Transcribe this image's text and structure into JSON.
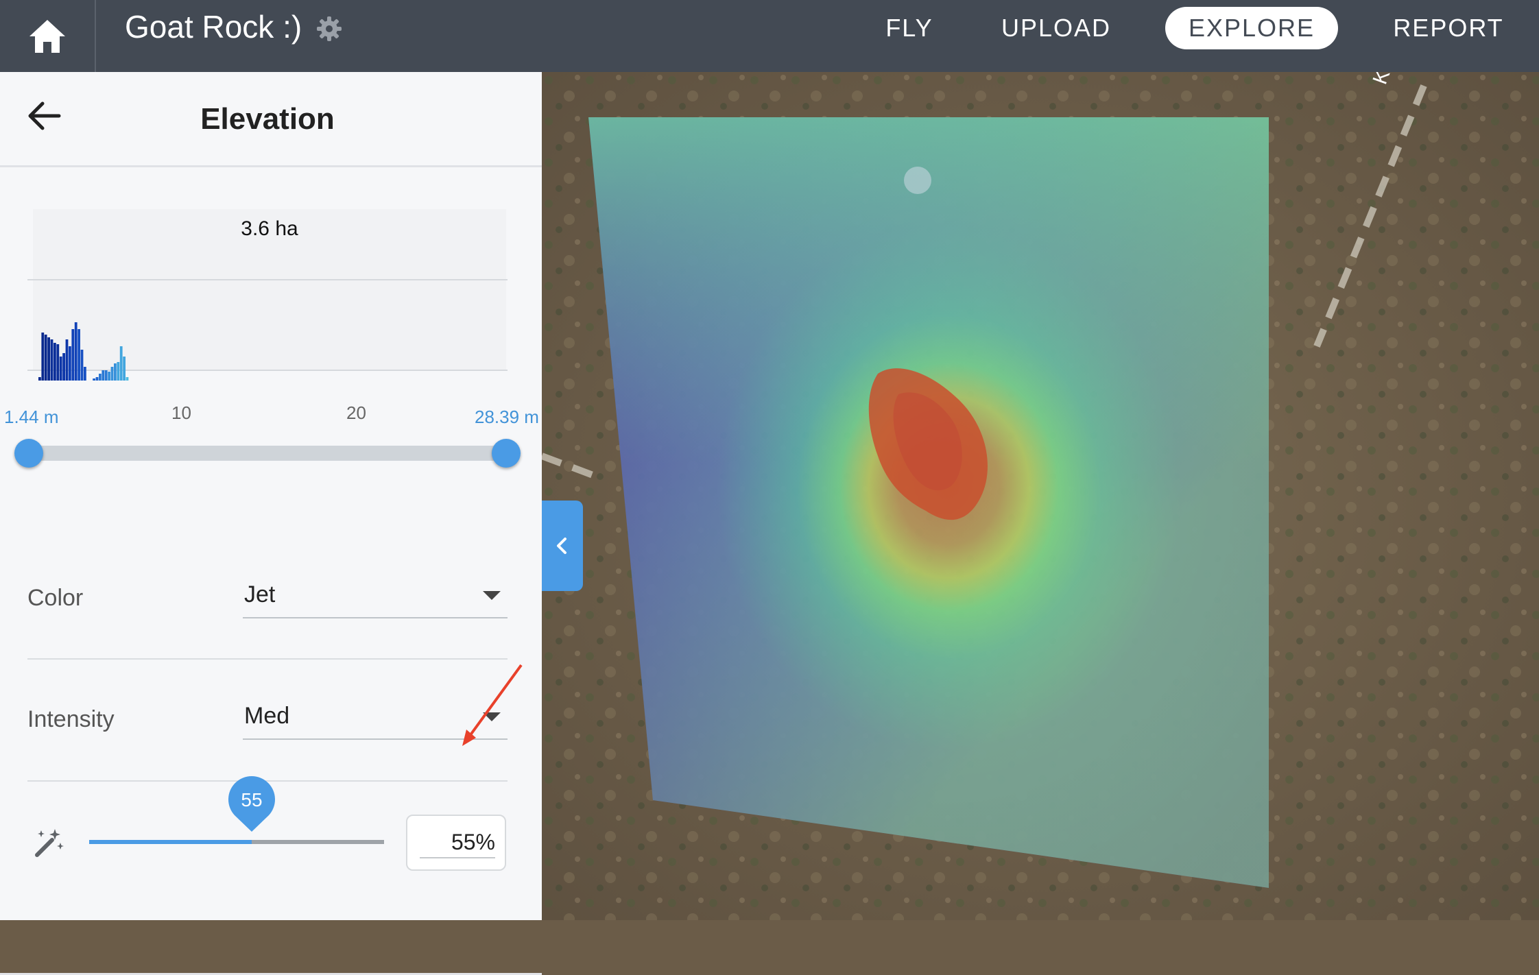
{
  "topbar": {
    "project_title": "Goat Rock :)",
    "tabs": [
      {
        "label": "FLY",
        "active": false
      },
      {
        "label": "UPLOAD",
        "active": false
      },
      {
        "label": "EXPLORE",
        "active": true
      },
      {
        "label": "REPORT",
        "active": false
      }
    ],
    "icons": {
      "home": "home-icon",
      "settings": "gear-icon"
    },
    "background_color": "#434a54"
  },
  "panel": {
    "title": "Elevation",
    "histogram": {
      "area_label": "3.6 ha",
      "ticks": [
        "1.44 m",
        "10",
        "20",
        "28.39 m"
      ],
      "range_min": 1.44,
      "range_max": 28.39,
      "colormap": "jet"
    },
    "color": {
      "label": "Color",
      "value": "Jet"
    },
    "intensity": {
      "label": "Intensity",
      "value": "Med"
    },
    "opacity": {
      "value": 55,
      "bubble": "55",
      "input_value": "55%",
      "icon": "magic-wand-icon"
    },
    "accent_color": "#4a9be5"
  },
  "map": {
    "road_label": "K",
    "layer": "elevation overlay (Jet colormap) over satellite imagery",
    "collapse_icon": "chevron-left-icon"
  }
}
